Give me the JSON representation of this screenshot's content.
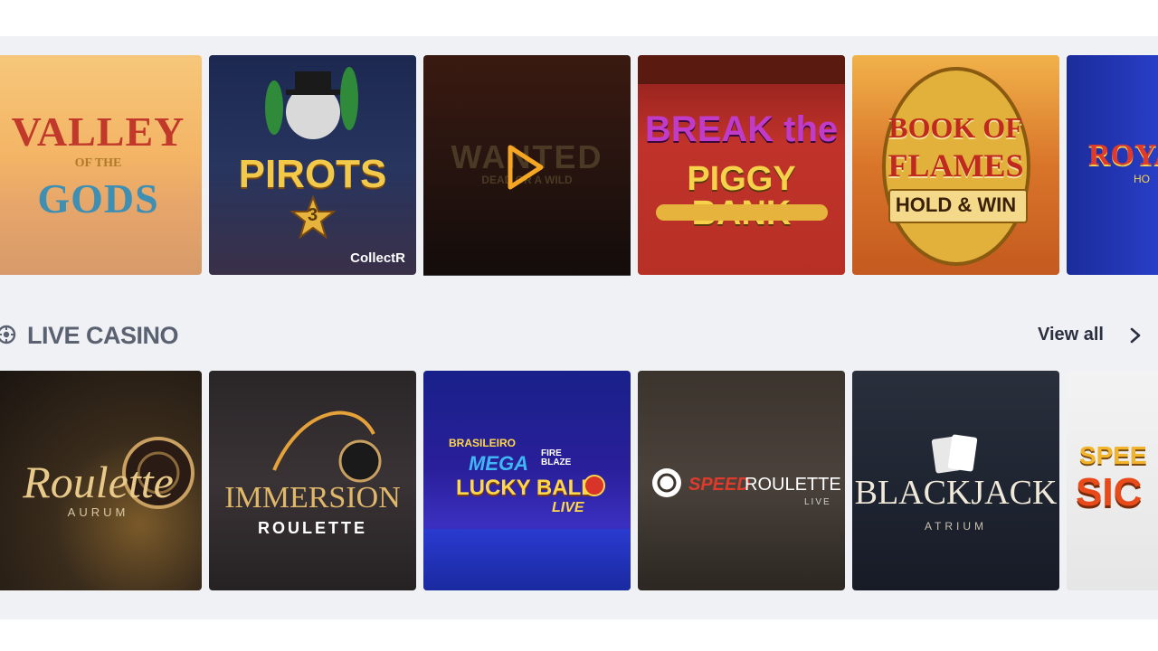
{
  "top_row": [
    {
      "title_line1": "VALLEY",
      "title_line2": "OF THE",
      "title_line3": "GODS"
    },
    {
      "title_line1": "PIROTS",
      "title_line2": "3",
      "badge": "CollectR"
    },
    {
      "title_line1": "WANTED",
      "title_line2": "DEAD OR A WILD",
      "playing": true
    },
    {
      "title_line1": "BREAK the",
      "title_line2": "PIGGY BANK"
    },
    {
      "title_line1": "BOOK OF",
      "title_line2": "FLAMES",
      "title_line3": "HOLD & WIN"
    },
    {
      "title_line1": "ROYA",
      "title_line2": "HO"
    }
  ],
  "live_casino": {
    "title": "LIVE CASINO",
    "view_all": "View all",
    "tiles": [
      {
        "title_line1": "Roulette",
        "title_line2": "AURUM"
      },
      {
        "title_line1": "IMMERSION",
        "title_line2": "ROULETTE"
      },
      {
        "title_line1": "BRASILEIRO",
        "title_line2": "MEGA",
        "title_line3": "FIRE BLAZE",
        "title_line4": "LUCKY BALL",
        "title_line5": "LIVE"
      },
      {
        "title_line1": "SPEED",
        "title_line2": "ROULETTE",
        "title_line3": "LIVE"
      },
      {
        "title_line1": "BLACKJACK",
        "title_line2": "ATRIUM"
      },
      {
        "title_line1": "SPEE",
        "title_line2": "SIC"
      }
    ]
  },
  "colors": {
    "background": "#f0f1f5",
    "section_title": "#5a6272",
    "view_all": "#2b3040",
    "play_accent": "#f5a623"
  },
  "icons": {
    "section": "live-casino-icon",
    "chevron": "chevron-right-icon",
    "play": "play-icon"
  }
}
